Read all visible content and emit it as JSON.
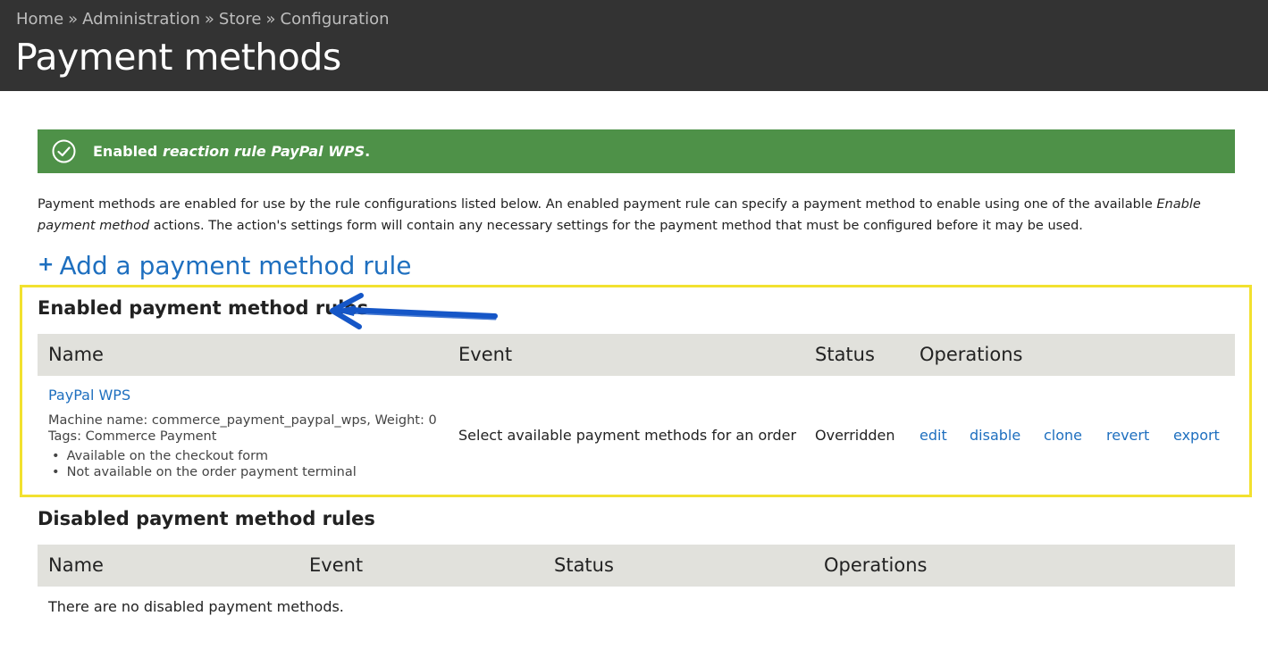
{
  "header": {
    "breadcrumb": [
      "Home",
      "Administration",
      "Store",
      "Configuration"
    ],
    "separator": "»",
    "title": "Payment methods"
  },
  "status_message": {
    "prefix": "Enabled",
    "emphasis": "reaction rule PayPal WPS",
    "suffix": ".",
    "icon": "check-circle-icon"
  },
  "description": {
    "part1": "Payment methods are enabled for use by the rule configurations listed below. An enabled payment rule can specify a payment method to enable using one of the available ",
    "emphasis": "Enable payment method",
    "part2": " actions. The action's settings form will contain any necessary settings for the payment method that must be configured before it may be used."
  },
  "add_link": {
    "icon": "+",
    "label": "Add a payment method rule"
  },
  "enabled_section": {
    "title": "Enabled payment method rules",
    "columns": [
      "Name",
      "Event",
      "Status",
      "Operations"
    ],
    "rows": [
      {
        "name": "PayPal WPS",
        "machine_name": "Machine name: commerce_payment_paypal_wps, Weight: 0",
        "tags": "Tags: Commerce Payment",
        "bullets": [
          "Available on the checkout form",
          "Not available on the order payment terminal"
        ],
        "event": "Select available payment methods for an order",
        "status": "Overridden",
        "operations": [
          "edit",
          "disable",
          "clone",
          "revert",
          "export"
        ]
      }
    ]
  },
  "disabled_section": {
    "title": "Disabled payment method rules",
    "columns": [
      "Name",
      "Event",
      "Status",
      "Operations"
    ],
    "empty_text": "There are no disabled payment methods."
  },
  "annotation": {
    "highlight_color": "#f2e12f",
    "arrow_color": "#1556c7"
  },
  "colors": {
    "header_bg": "#333333",
    "status_bg": "#4e9148",
    "link": "#1e6fbf",
    "table_header_bg": "#e1e1dc"
  }
}
